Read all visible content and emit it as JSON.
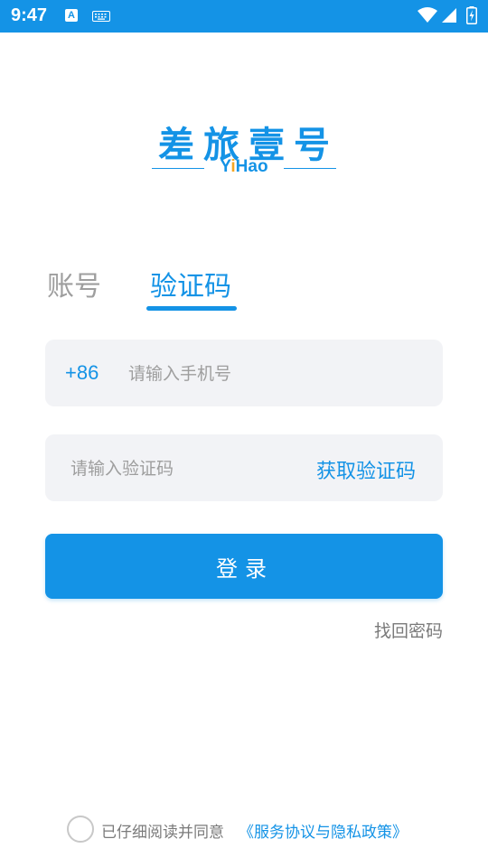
{
  "status_bar": {
    "time": "9:47",
    "notification_icon_letter": "A",
    "icons": [
      "keyboard-icon",
      "wifi-icon",
      "signal-icon",
      "battery-charging-icon"
    ]
  },
  "logo": {
    "title": "差旅壹号",
    "subtitle_pre": "Y",
    "subtitle_i": "i",
    "subtitle_post": "Hao"
  },
  "tabs": [
    {
      "label": "账号",
      "active": false
    },
    {
      "label": "验证码",
      "active": true
    }
  ],
  "phone_field": {
    "country_code": "+86",
    "placeholder": "请输入手机号",
    "value": ""
  },
  "code_field": {
    "placeholder": "请输入验证码",
    "value": "",
    "get_code_label": "获取验证码"
  },
  "login_button": {
    "label": "登录"
  },
  "forgot_link": {
    "label": "找回密码"
  },
  "agreement": {
    "checked": false,
    "text": "已仔细阅读并同意",
    "link": "《服务协议与隐私政策》"
  },
  "colors": {
    "primary": "#1493E6",
    "accent": "#F5A623",
    "input_bg": "#F2F3F6",
    "muted_text": "#9E9E9E"
  }
}
